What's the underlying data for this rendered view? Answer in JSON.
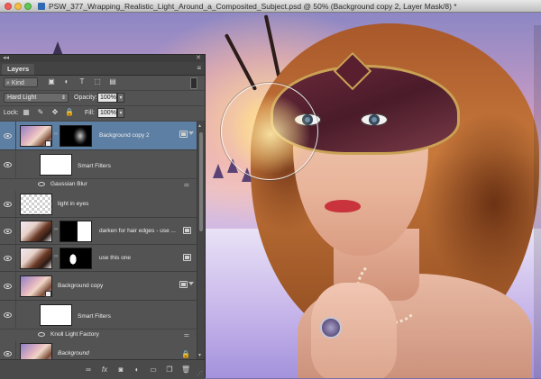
{
  "window": {
    "title": "PSW_377_Wrapping_Realistic_Light_Around_a_Composited_Subject.psd @ 50% (Background copy 2, Layer Mask/8) *"
  },
  "layers_panel": {
    "tab": "Layers",
    "filter": {
      "kind": "Kind"
    },
    "blend": {
      "mode": "Hard Light",
      "opacity_label": "Opacity:",
      "opacity_value": "100%"
    },
    "lock": {
      "label": "Lock:",
      "fill_label": "Fill:",
      "fill_value": "100%"
    },
    "layers": [
      {
        "name": "Background copy 2",
        "visible": true,
        "selected": true
      },
      {
        "sub": "Smart Filters"
      },
      {
        "filter": "Gaussian Blur"
      },
      {
        "name": "light in eyes",
        "visible": true
      },
      {
        "name": "darken for hair edges - use ...",
        "visible": true
      },
      {
        "name": "use this one",
        "visible": true
      },
      {
        "name": "Background copy",
        "visible": true
      },
      {
        "sub": "Smart Filters"
      },
      {
        "filter": "Knoll Light Factory"
      },
      {
        "name": "Background",
        "visible": true,
        "locked": true
      }
    ]
  },
  "icons": {
    "filter": [
      "pixel-filter-icon",
      "adjustment-filter-icon",
      "type-filter-icon",
      "shape-filter-icon",
      "smart-object-filter-icon"
    ],
    "lock": [
      "lock-transparent-icon",
      "lock-image-icon",
      "lock-position-icon",
      "lock-all-icon"
    ],
    "footer": [
      "link-layers-icon",
      "fx-icon",
      "add-mask-icon",
      "adjustment-layer-icon",
      "group-icon",
      "new-layer-icon",
      "trash-icon"
    ]
  },
  "colors": {
    "panel_bg": "#535353",
    "selected_row": "#5d7fa4"
  }
}
